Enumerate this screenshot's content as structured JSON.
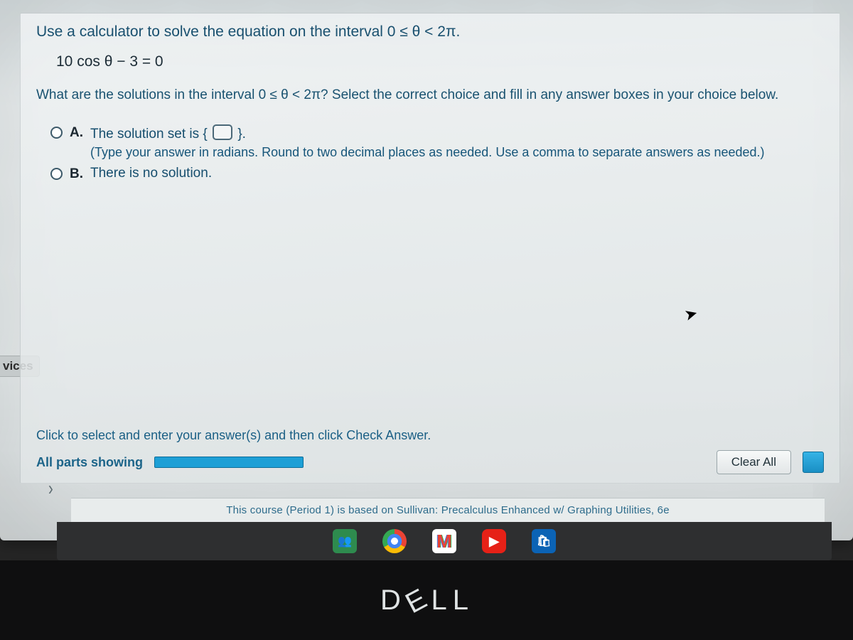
{
  "sidebar": {
    "tag": "vices"
  },
  "question": {
    "prompt1_a": "Use a calculator to solve the equation on the interval 0 ≤ θ < 2π.",
    "equation": "10 cos θ − 3 = 0",
    "prompt2": "What are the solutions in the interval 0 ≤ θ < 2π? Select the correct choice and fill in any answer boxes in your choice below.",
    "choices": {
      "A": {
        "label": "A.",
        "text_before": "The solution set is {",
        "text_after": "}.",
        "hint": "(Type your answer in radians.  Round to two decimal places as needed.  Use a comma to separate answers as needed.)"
      },
      "B": {
        "label": "B.",
        "text": "There is no solution."
      }
    }
  },
  "footer": {
    "instruction": "Click to select and enter your answer(s) and then click Check Answer.",
    "parts_label": "All parts showing",
    "clear_label": "Clear All"
  },
  "course_text": "This course (Period 1) is based on Sullivan: Precalculus Enhanced w/ Graphing Utilities, 6e",
  "brand": {
    "d": "D",
    "e": "E",
    "l1": "L",
    "l2": "L"
  },
  "icons": {
    "yt": "▶",
    "help": "🛍",
    "class": "👥"
  }
}
